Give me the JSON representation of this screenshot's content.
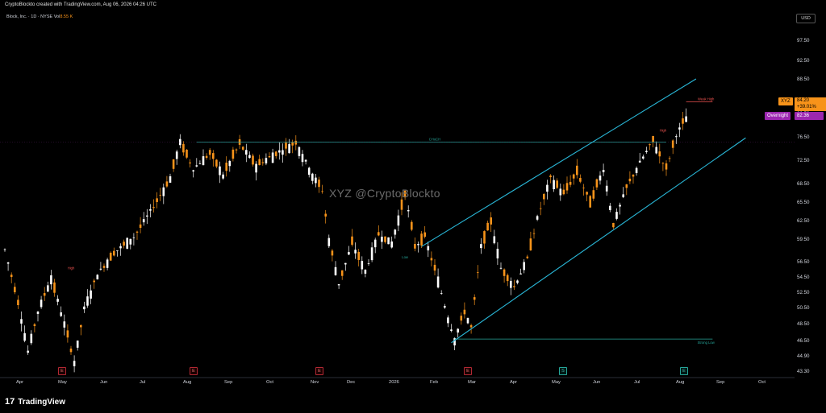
{
  "header": {
    "created_text": "CryptoBlockto created with TradingView.com, Aug 06, 2026 04:26 UTC"
  },
  "legend": {
    "symbol_text": "Block, Inc. · 1D · NYSE",
    "vol_label": "Vol",
    "vol_value": "8.55 K"
  },
  "currency": "USD",
  "watermark": "XYZ   @CryptoBlockto",
  "footer": {
    "logo": "17",
    "brand": "TradingView"
  },
  "price_flags": {
    "ticker": "XYZ",
    "last_price": "84.20",
    "change_pct": "+39.01%",
    "overnight_label": "Overnight",
    "overnight_price": "82.36"
  },
  "colors": {
    "up": "#ffffff",
    "down": "#f7931a",
    "trendline": "#29b6d6",
    "level": "#26a69a",
    "high_marker": "#ef5350"
  },
  "annotations": {
    "choch": "CHoCH",
    "strong_low": "Strong Low",
    "weak_high": "Weak High",
    "high_left": "High",
    "high_right": "High",
    "low_mid": "Low"
  },
  "events": [
    {
      "type": "e",
      "label": "E"
    },
    {
      "type": "e",
      "label": "E"
    },
    {
      "type": "e",
      "label": "E"
    },
    {
      "type": "e",
      "label": "E"
    },
    {
      "type": "s",
      "label": "S"
    },
    {
      "type": "s",
      "label": "E"
    }
  ],
  "chart_data": {
    "type": "candlestick",
    "symbol": "XYZ",
    "x_labels": [
      "Apr",
      "May",
      "Jun",
      "Jul",
      "Aug",
      "Sep",
      "Oct",
      "Nov",
      "Dec",
      "2026",
      "Feb",
      "Mar",
      "Apr",
      "May",
      "Jun",
      "Jul",
      "Aug",
      "Sep",
      "Oct"
    ],
    "y_ticks": [
      "97.50",
      "92.50",
      "88.50",
      "80.50",
      "76.50",
      "72.50",
      "68.50",
      "65.50",
      "62.50",
      "59.50",
      "56.50",
      "54.50",
      "52.50",
      "50.50",
      "48.50",
      "46.50",
      "44.90",
      "43.30"
    ],
    "ylim": [
      43.3,
      97.5
    ],
    "swing_path": [
      {
        "x": 0,
        "y": 63.0
      },
      {
        "x": 4,
        "y": 54.5
      },
      {
        "x": 7,
        "y": 46.6
      },
      {
        "x": 10,
        "y": 53.0
      },
      {
        "x": 14,
        "y": 58.5
      },
      {
        "x": 18,
        "y": 51.0
      },
      {
        "x": 21,
        "y": 44.9
      },
      {
        "x": 24,
        "y": 53.5
      },
      {
        "x": 28,
        "y": 59.0
      },
      {
        "x": 33,
        "y": 62.5
      },
      {
        "x": 39,
        "y": 65.0
      },
      {
        "x": 45,
        "y": 70.0
      },
      {
        "x": 50,
        "y": 74.5
      },
      {
        "x": 53,
        "y": 80.3
      },
      {
        "x": 57,
        "y": 76.0
      },
      {
        "x": 62,
        "y": 78.5
      },
      {
        "x": 66,
        "y": 75.0
      },
      {
        "x": 71,
        "y": 80.0
      },
      {
        "x": 76,
        "y": 76.5
      },
      {
        "x": 82,
        "y": 78.5
      },
      {
        "x": 88,
        "y": 80.3
      },
      {
        "x": 93,
        "y": 75.0
      },
      {
        "x": 96,
        "y": 72.5
      },
      {
        "x": 98,
        "y": 64.5
      },
      {
        "x": 101,
        "y": 57.5
      },
      {
        "x": 105,
        "y": 64.0
      },
      {
        "x": 109,
        "y": 59.5
      },
      {
        "x": 113,
        "y": 65.5
      },
      {
        "x": 117,
        "y": 64.0
      },
      {
        "x": 121,
        "y": 72.0
      },
      {
        "x": 124,
        "y": 63.5
      },
      {
        "x": 127,
        "y": 65.0
      },
      {
        "x": 131,
        "y": 58.0
      },
      {
        "x": 134,
        "y": 52.0
      },
      {
        "x": 136,
        "y": 48.6
      },
      {
        "x": 139,
        "y": 53.0
      },
      {
        "x": 141,
        "y": 50.5
      },
      {
        "x": 144,
        "y": 63.5
      },
      {
        "x": 147,
        "y": 67.5
      },
      {
        "x": 150,
        "y": 60.0
      },
      {
        "x": 154,
        "y": 57.0
      },
      {
        "x": 158,
        "y": 61.5
      },
      {
        "x": 161,
        "y": 68.0
      },
      {
        "x": 165,
        "y": 74.5
      },
      {
        "x": 169,
        "y": 72.0
      },
      {
        "x": 173,
        "y": 75.5
      },
      {
        "x": 177,
        "y": 70.5
      },
      {
        "x": 181,
        "y": 76.0
      },
      {
        "x": 184,
        "y": 67.0
      },
      {
        "x": 188,
        "y": 73.0
      },
      {
        "x": 192,
        "y": 77.0
      },
      {
        "x": 196,
        "y": 80.5
      },
      {
        "x": 200,
        "y": 76.0
      },
      {
        "x": 203,
        "y": 81.5
      },
      {
        "x": 206,
        "y": 84.2
      }
    ],
    "levels": [
      {
        "name": "CHoCH",
        "price": 80.3
      },
      {
        "name": "Strong Low",
        "price": 48.6
      },
      {
        "name": "Weak High",
        "price": 86.8
      }
    ],
    "channel": {
      "upper": [
        {
          "x": 126,
          "y": 63.5
        },
        {
          "x": 209,
          "y": 90.5
        }
      ],
      "lower": [
        {
          "x": 135,
          "y": 48.0
        },
        {
          "x": 224,
          "y": 81.0
        }
      ]
    }
  }
}
